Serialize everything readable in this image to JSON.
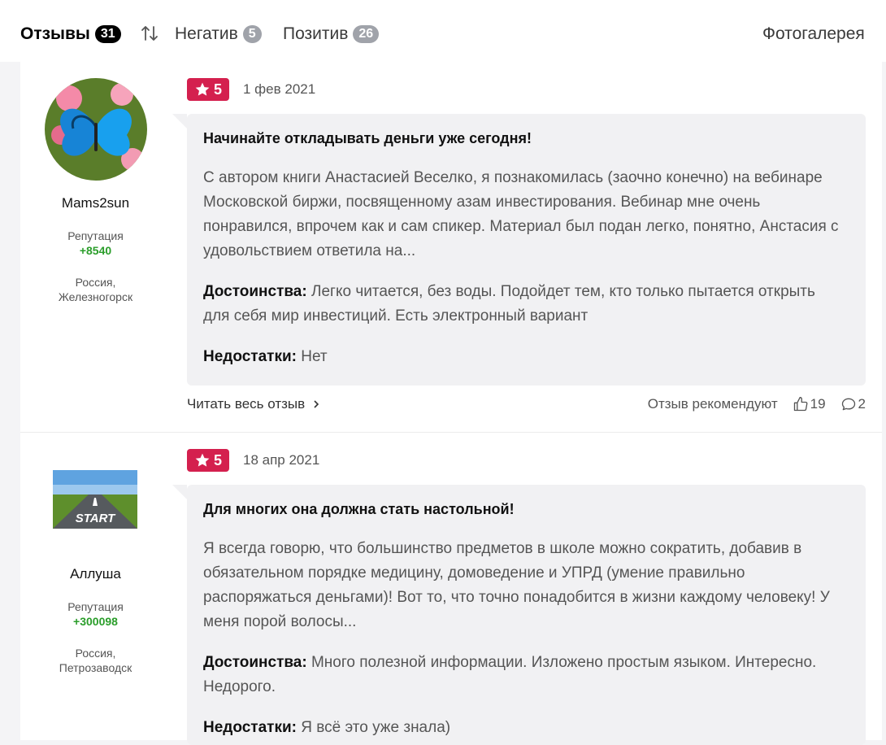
{
  "tabs": {
    "reviews": {
      "label": "Отзывы",
      "count": "31"
    },
    "negative": {
      "label": "Негатив",
      "count": "5"
    },
    "positive": {
      "label": "Позитив",
      "count": "26"
    },
    "gallery": {
      "label": "Фотогалерея"
    }
  },
  "reviews": [
    {
      "author": "Mams2sun",
      "reputation_label": "Репутация",
      "reputation": "+8540",
      "location_line1": "Россия,",
      "location_line2": "Железногорск",
      "rating": "5",
      "date": "1 фев 2021",
      "title": "Начинайте откладывать деньги уже сегодня!",
      "text": "С автором книги Анастасией Веселко, я познакомилась (заочно конечно) на вебинаре Московской биржи, посвященному азам инвестирования. Вебинар мне очень понравился, впрочем как и сам спикер. Материал был подан легко, понятно, Анстасия с удовольствием ответила на...",
      "pros_label": "Достоинства:",
      "pros": "Легко читается, без воды. Подойдет тем, кто только пытается открыть для себя мир инвестиций. Есть электронный вариант",
      "cons_label": "Недостатки:",
      "cons": "Нет",
      "read_more": "Читать весь отзыв",
      "recommend_label": "Отзыв рекомендуют",
      "likes": "19",
      "comments": "2"
    },
    {
      "author": "Аллуша",
      "avatar_text": "START",
      "reputation_label": "Репутация",
      "reputation": "+300098",
      "location_line1": "Россия,",
      "location_line2": "Петрозаводск",
      "rating": "5",
      "date": "18 апр 2021",
      "title": "Для многих она должна стать настольной!",
      "text": "Я всегда говорю, что большинство предметов в школе можно сократить, добавив в обязательном порядке медицину, домоведение и УПРД (умение правильно распоряжаться деньгами)! Вот то, что точно понадобится в жизни каждому человеку! У меня порой волосы...",
      "pros_label": "Достоинства:",
      "pros": "Много полезной информации. Изложено простым языком. Интересно. Недорого.",
      "cons_label": "Недостатки:",
      "cons": "Я всё это уже знала)"
    }
  ],
  "colors": {
    "rating_badge": "#d4204e",
    "reputation": "#2a9d2a",
    "bubble": "#f1f1f3"
  },
  "icons": [
    "sort-icon",
    "star-icon",
    "chevron-right-icon",
    "thumbs-up-icon",
    "comment-icon"
  ]
}
